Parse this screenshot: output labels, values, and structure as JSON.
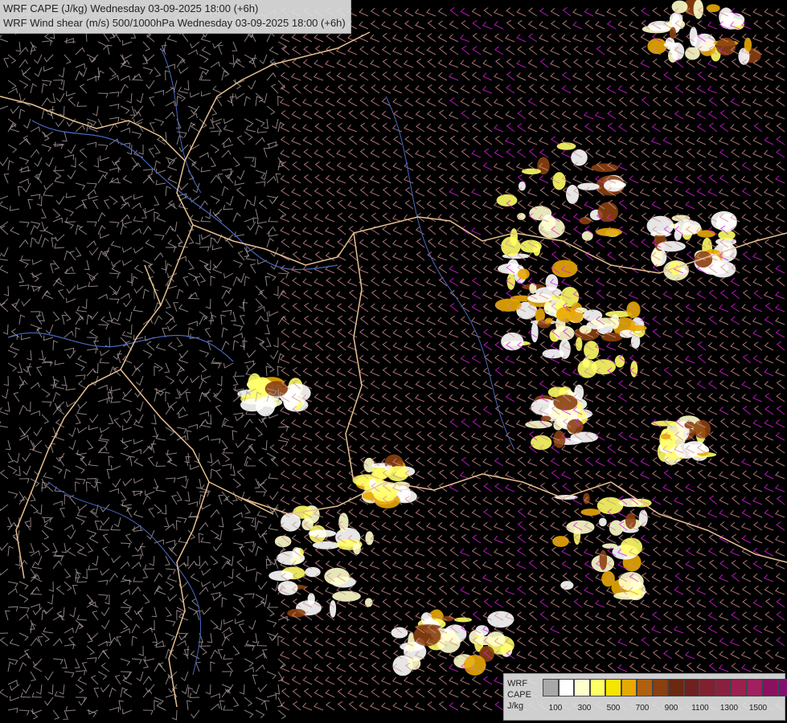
{
  "titles": {
    "line1": "WRF CAPE (J/kg) Wednesday 03-09-2025 18:00 (+6h)",
    "line2": "WRF Wind shear (m/s) 500/1000hPa Wednesday 03-09-2025 18:00 (+6h)"
  },
  "legend": {
    "line1": "WRF",
    "line2": "CAPE",
    "line3": "J/kg",
    "colors": [
      "#a8a8a8",
      "#ffffff",
      "#ffffcc",
      "#ffff66",
      "#f5e500",
      "#e8a800",
      "#b06010",
      "#8a4010",
      "#6a2a10",
      "#702020",
      "#802030",
      "#8a2040",
      "#9a2050",
      "#a02060",
      "#8a1060",
      "#801070",
      "#6a1070"
    ],
    "ticks": [
      "100",
      "300",
      "500",
      "700",
      "900",
      "1100",
      "1300",
      "1500"
    ]
  },
  "map_colors": {
    "background": "#000000",
    "barb_light": "#b0a0a0",
    "barb_pink": "#d49090",
    "barb_magenta": "#e020e0",
    "border": "#e8c090",
    "river": "#5070c8"
  }
}
